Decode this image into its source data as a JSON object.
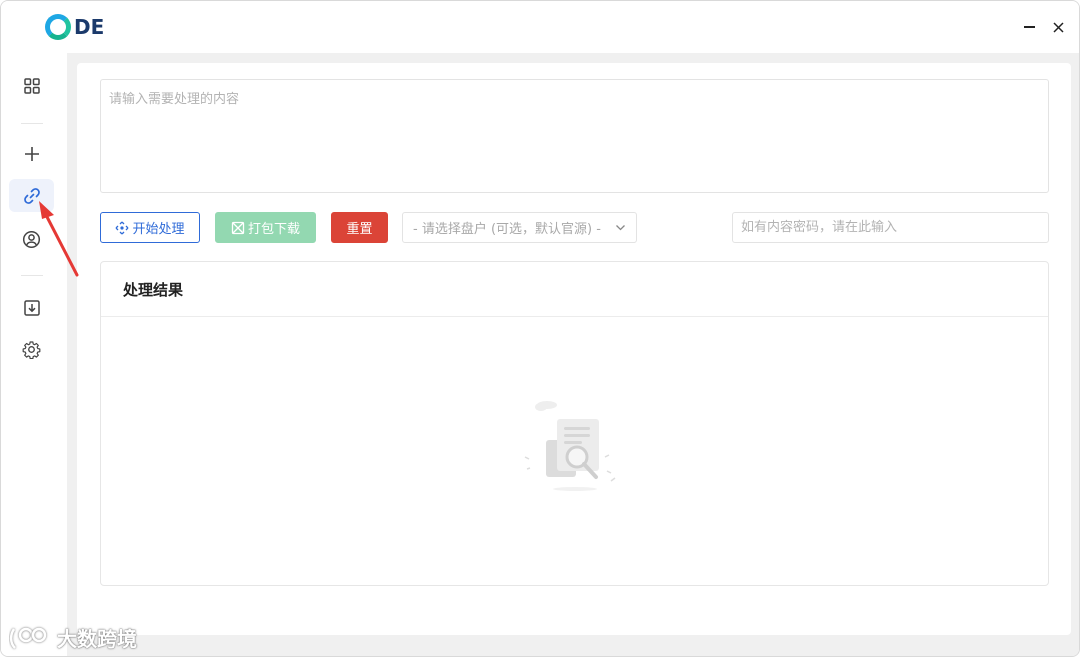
{
  "app": {
    "logo_text": "DE"
  },
  "window_controls": {
    "minimize": "minimize",
    "close": "close"
  },
  "sidebar": {
    "items": [
      {
        "icon": "grid-icon",
        "active": false
      },
      {
        "icon": "plus-icon",
        "active": false
      },
      {
        "icon": "link-icon",
        "active": true
      },
      {
        "icon": "user-circle-icon",
        "active": false
      },
      {
        "icon": "download-box-icon",
        "active": false
      },
      {
        "icon": "gear-icon",
        "active": false
      }
    ]
  },
  "input": {
    "placeholder": "请输入需要处理的内容",
    "value": ""
  },
  "toolbar": {
    "start_label": "开始处理",
    "pack_label": "打包下载",
    "reset_label": "重置",
    "drive_select": "- 请选择盘户 (可选，默认官源) -",
    "password_placeholder": "如有内容密码，请在此输入"
  },
  "result": {
    "title": "处理结果"
  },
  "watermark": {
    "text": "大数跨境"
  },
  "colors": {
    "primary": "#2f6bd8",
    "pack_disabled": "#93d8b1",
    "danger": "#db4437",
    "annotation_arrow": "#e53935"
  }
}
